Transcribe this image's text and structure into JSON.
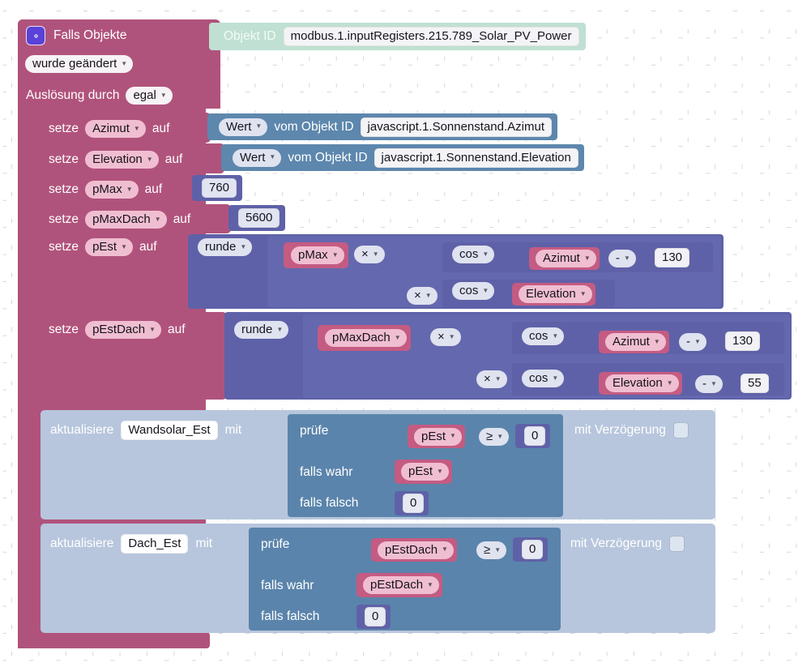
{
  "workspace": {
    "grid": "dot-cross-grid"
  },
  "event_block": {
    "icon": "gear-icon",
    "title": "Falls Objekte",
    "trigger_mode": "wurde geändert",
    "trigger_by_label": "Auslösung durch",
    "trigger_by_value": "egal",
    "object_id_label": "Objekt ID",
    "object_id_value": "modbus.1.inputRegisters.215.789_Solar_PV_Power"
  },
  "statements": [
    {
      "kind": "set",
      "keyword": "setze",
      "variable": "Azimut",
      "to": "auf",
      "value_block": {
        "kind": "get-object-value",
        "selector": "Wert",
        "label": "vom Objekt ID",
        "object_id": "javascript.1.Sonnenstand.Azimut"
      }
    },
    {
      "kind": "set",
      "keyword": "setze",
      "variable": "Elevation",
      "to": "auf",
      "value_block": {
        "kind": "get-object-value",
        "selector": "Wert",
        "label": "vom Objekt ID",
        "object_id": "javascript.1.Sonnenstand.Elevation"
      }
    },
    {
      "kind": "set",
      "keyword": "setze",
      "variable": "pMax",
      "to": "auf",
      "value_block": {
        "kind": "number",
        "value": "760"
      }
    },
    {
      "kind": "set",
      "keyword": "setze",
      "variable": "pMaxDach",
      "to": "auf",
      "value_block": {
        "kind": "number",
        "value": "5600"
      }
    }
  ],
  "pest": {
    "keyword": "setze",
    "variable": "pEst",
    "to": "auf",
    "round_op": "runde",
    "operand": "pMax",
    "mult_op_outer": "×",
    "mult_op_inner": "×",
    "trig_1": "cos",
    "trig_1_arg": "Azimut",
    "trig_1_sub_op": "-",
    "trig_1_sub_val": "130",
    "trig_2": "cos",
    "trig_2_arg": "Elevation"
  },
  "pestdach": {
    "keyword": "setze",
    "variable": "pEstDach",
    "to": "auf",
    "round_op": "runde",
    "operand": "pMaxDach",
    "mult_op_outer": "×",
    "mult_op_inner": "×",
    "trig_1": "cos",
    "trig_1_arg": "Azimut",
    "trig_1_sub_op": "-",
    "trig_1_sub_val": "130",
    "trig_2": "cos",
    "trig_2_arg": "Elevation",
    "trig_2_sub_op": "-",
    "trig_2_sub_val": "55"
  },
  "updates": [
    {
      "keyword": "aktualisiere",
      "target": "Wandsolar_Est",
      "with": "mit",
      "delay_label": "mit Verzögerung",
      "delay_checked": false,
      "ternary": {
        "test_label": "prüfe",
        "true_label": "falls wahr",
        "false_label": "falls falsch",
        "test_left": "pEst",
        "test_op": "≥",
        "test_right": "0",
        "true_value": "pEst",
        "false_value": "0"
      }
    },
    {
      "keyword": "aktualisiere",
      "target": "Dach_Est",
      "with": "mit",
      "delay_label": "mit Verzögerung",
      "delay_checked": false,
      "ternary": {
        "test_label": "prüfe",
        "true_label": "falls wahr",
        "false_label": "falls falsch",
        "test_left": "pEstDach",
        "test_op": "≥",
        "test_right": "0",
        "true_value": "pEstDach",
        "false_value": "0"
      }
    }
  ],
  "colors": {
    "event": "#b0537c",
    "object_id": "#bfe0d2",
    "steel": "#5d87ad",
    "indigo": "#5f61a8",
    "variable": "#c45b82",
    "control": "#b7c6dd"
  }
}
